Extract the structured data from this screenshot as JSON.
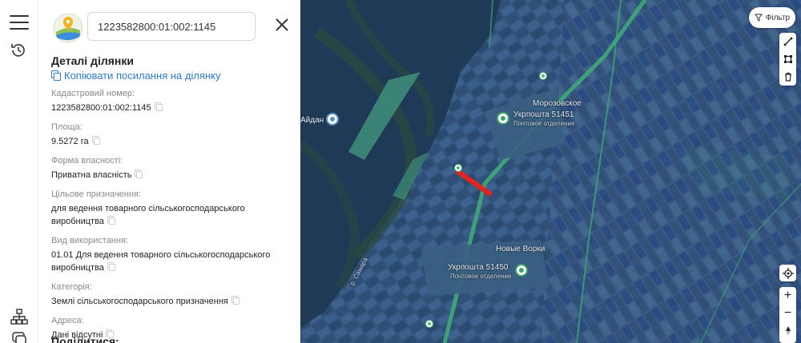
{
  "search": {
    "value": "1223582800:01:002:1145"
  },
  "panel": {
    "title": "Деталі ділянки",
    "copy_link": "Копіювати посилання на ділянку",
    "share_title": "Поділитися:"
  },
  "fields": [
    {
      "label": "Кадастровий номер:",
      "value": "1223582800:01:002:1145"
    },
    {
      "label": "Площа:",
      "value": "9.5272 га"
    },
    {
      "label": "Форма власності:",
      "value": "Приватна власність"
    },
    {
      "label": "Цільове призначення:",
      "value": "для ведення товарного сільськогосподарського виробництва"
    },
    {
      "label": "Вид використання:",
      "value": "01.01 Для ведення товарного сільськогосподарського виробництва"
    },
    {
      "label": "Категорія:",
      "value": "Землі сільськогосподарського призначення"
    },
    {
      "label": "Адреса:",
      "value": "Дані відсутні"
    }
  ],
  "map": {
    "filter_label": "Фільтр",
    "places": {
      "morozovskoe": "Морозовское",
      "novye_vorki": "Новые Ворки",
      "ukrposhta_1": "Укрпошта 51451",
      "post_office_1": "Почтовое отделение",
      "ukrposhta_2": "Укрпошта 51450",
      "post_office_2": "Почтовое отделение",
      "aydan": "Айдан",
      "river": "р. Самара"
    },
    "zoom_in": "+",
    "zoom_out": "−",
    "highlight_color": "#e02424"
  }
}
